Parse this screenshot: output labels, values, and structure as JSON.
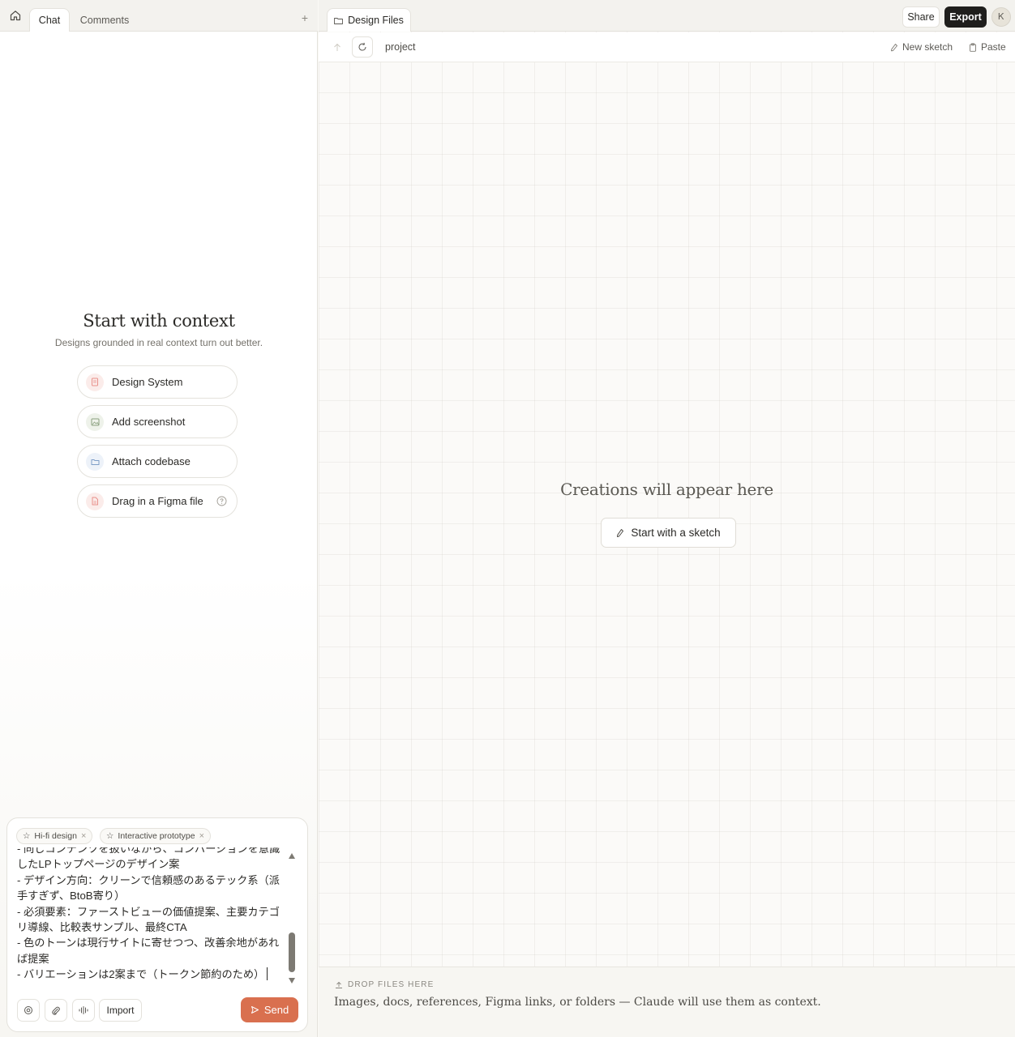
{
  "left_tabs": {
    "chat": "Chat",
    "comments": "Comments",
    "add": "+"
  },
  "context": {
    "title": "Start with context",
    "subtitle": "Designs grounded in real context turn out better.",
    "options": [
      {
        "label": "Design System",
        "icon": "book-icon",
        "color": "#e8908a"
      },
      {
        "label": "Add screenshot",
        "icon": "image-icon",
        "color": "#8aa07e"
      },
      {
        "label": "Attach codebase",
        "icon": "folder-icon",
        "color": "#7f9ec7"
      },
      {
        "label": "Drag in a Figma file",
        "icon": "figma-file-icon",
        "color": "#e8908a"
      }
    ]
  },
  "composer": {
    "chips": [
      "Hi-fi design",
      "Interactive prototype"
    ],
    "lines": [
      "- 同じコンテンツを扱いながら、コンバージョンを意識したLPトップページのデザイン案",
      "- デザイン方向：クリーンで信頼感のあるテック系（派手すぎず、BtoB寄り）",
      "- 必須要素：ファーストビューの価値提案、主要カテゴリ導線、比較表サンプル、最終CTA",
      "- 色のトーンは現行サイトに寄せつつ、改善余地があれば提案",
      "- バリエーションは2案まで（トークン節約のため）"
    ],
    "import": "Import",
    "send": "Send",
    "send_color": "#d9704f"
  },
  "right_top": {
    "tab": "Design Files",
    "share": "Share",
    "export": "Export",
    "avatar": "Ꮶ"
  },
  "toolbar": {
    "path": "project",
    "new_sketch": "New sketch",
    "paste": "Paste"
  },
  "canvas": {
    "empty_title": "Creations will appear here",
    "sketch_button": "Start with a sketch"
  },
  "drop": {
    "label": "DROP FILES HERE",
    "description": "Images, docs, references, Figma links, or folders — Claude will use them as context."
  }
}
